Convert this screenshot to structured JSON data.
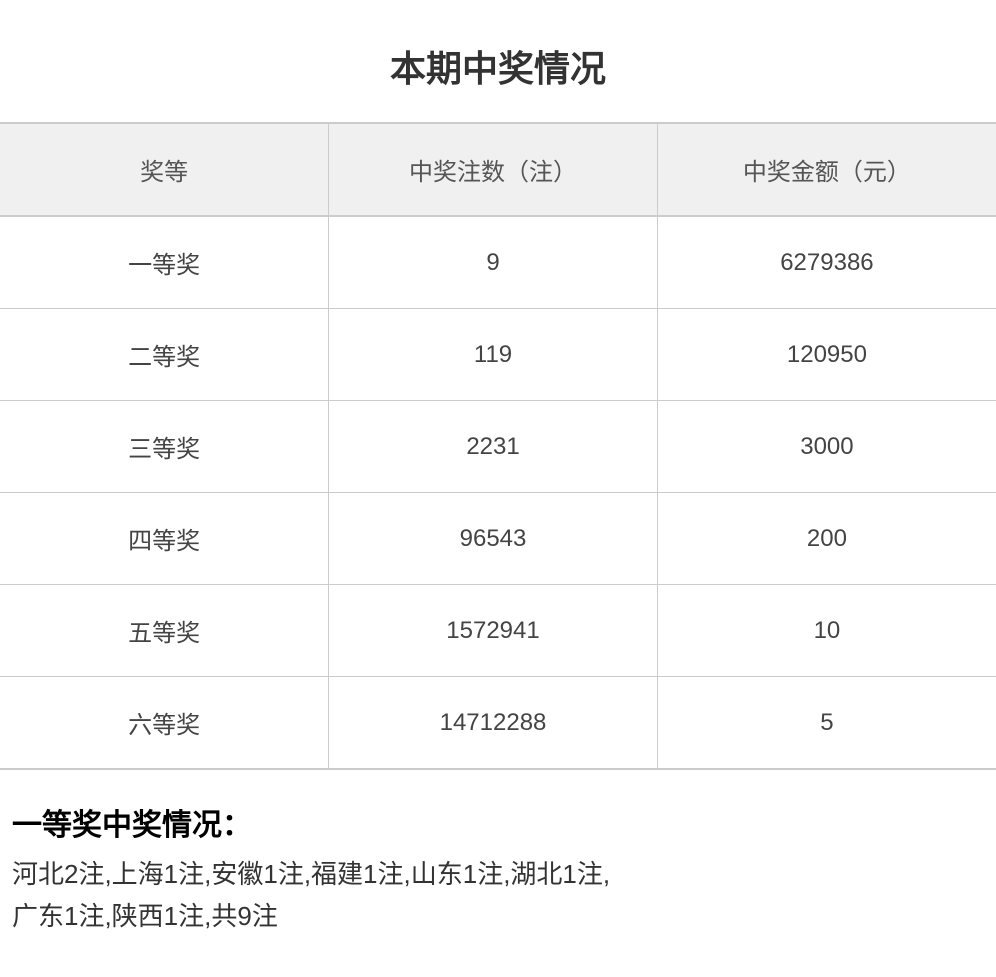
{
  "page": {
    "title": "本期中奖情况"
  },
  "table": {
    "headers": {
      "col1": "奖等",
      "col2": "中奖注数（注）",
      "col3": "中奖金额（元）"
    },
    "rows": [
      {
        "prize": "一等奖",
        "count": "9",
        "amount": "6279386"
      },
      {
        "prize": "二等奖",
        "count": "119",
        "amount": "120950"
      },
      {
        "prize": "三等奖",
        "count": "2231",
        "amount": "3000"
      },
      {
        "prize": "四等奖",
        "count": "96543",
        "amount": "200"
      },
      {
        "prize": "五等奖",
        "count": "1572941",
        "amount": "10"
      },
      {
        "prize": "六等奖",
        "count": "14712288",
        "amount": "5"
      }
    ]
  },
  "first_prize_section": {
    "title": "一等奖中奖情况：",
    "detail_line1": "河北2注,上海1注,安徽1注,福建1注,山东1注,湖北1注,",
    "detail_line2": "广东1注,陕西1注,共9注"
  }
}
